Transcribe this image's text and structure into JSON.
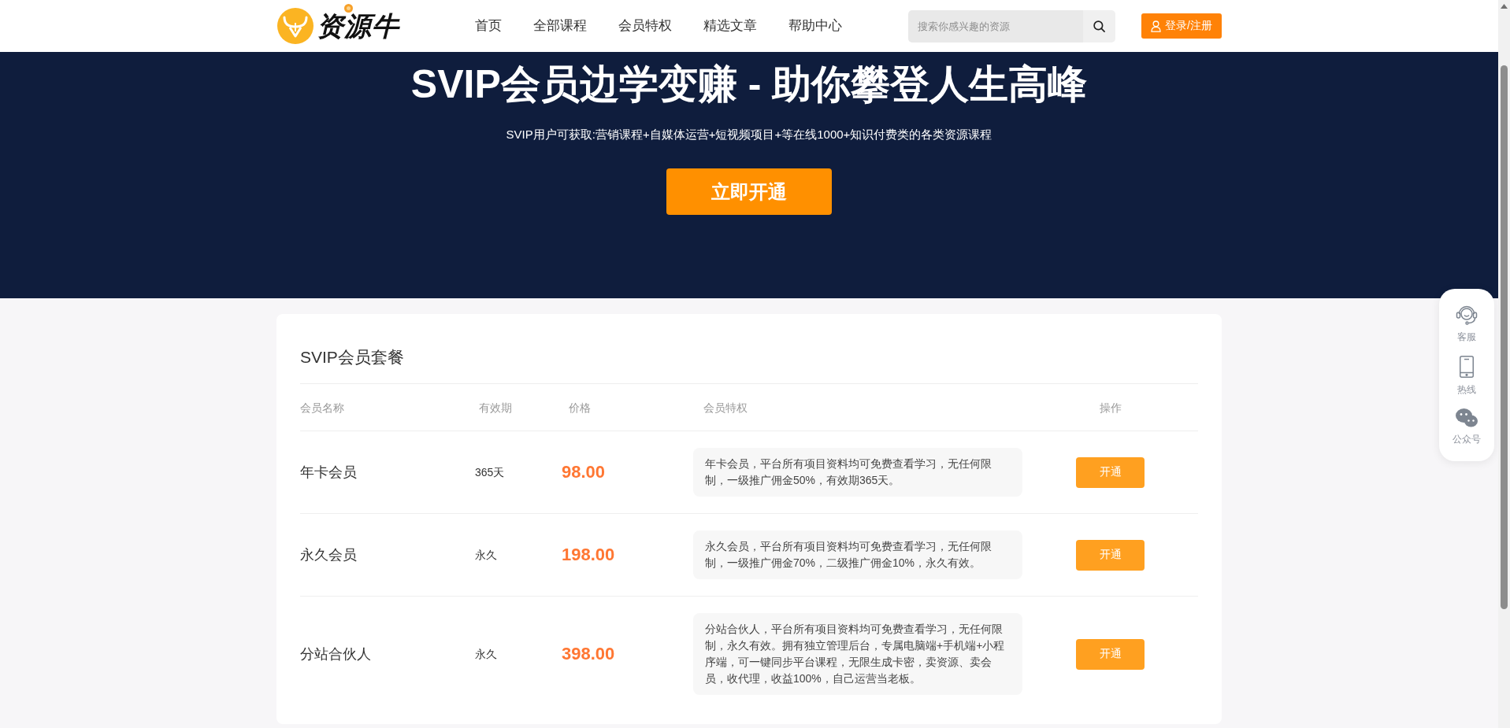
{
  "header": {
    "logo": {
      "text": "资源牛"
    },
    "nav": [
      {
        "label": "首页",
        "selected": false
      },
      {
        "label": "全部课程",
        "selected": false
      },
      {
        "label": "会员特权",
        "selected": false
      },
      {
        "label": "精选文章",
        "selected": false
      },
      {
        "label": "帮助中心",
        "selected": false
      }
    ],
    "search": {
      "placeholder": "搜索你感兴趣的资源"
    },
    "login_button": {
      "label": "登录/注册"
    }
  },
  "hero": {
    "title": "SVIP会员边学变赚 - 助你攀登人生高峰",
    "subtitle": "SVIP用户可获取:营销课程+自媒体运营+短视频项目+等在线1000+知识付费类的各类资源课程",
    "cta_button": {
      "label": "立即开通"
    }
  },
  "plans": {
    "title": "SVIP会员套餐",
    "columns": [
      "会员名称",
      "有效期",
      "价格",
      "会员特权",
      "操作"
    ],
    "rows": [
      {
        "name": "年卡会员",
        "validity": "365天",
        "price": "98.00",
        "benefits": "年卡会员，平台所有项目资料均可免费查看学习，无任何限制，一级推广佣金50%，有效期365天。",
        "action": "开通"
      },
      {
        "name": "永久会员",
        "validity": "永久",
        "price": "198.00",
        "benefits": "永久会员，平台所有项目资料均可免费查看学习，无任何限制，一级推广佣金70%，二级推广佣金10%，永久有效。",
        "action": "开通"
      },
      {
        "name": "分站合伙人",
        "validity": "永久",
        "price": "398.00",
        "benefits": "分站合伙人，平台所有项目资料均可免费查看学习，无任何限制，永久有效。拥有独立管理后台，专属电脑端+手机端+小程序端，可一键同步平台课程，无限生成卡密，卖资源、卖会员，收代理，收益100%，自己运营当老板。",
        "action": "开通"
      }
    ]
  },
  "side_panel": {
    "items": [
      {
        "kind": "headset",
        "label": "客服"
      },
      {
        "kind": "phone",
        "label": "热线"
      },
      {
        "kind": "wechat",
        "label": "公众号"
      }
    ]
  }
}
